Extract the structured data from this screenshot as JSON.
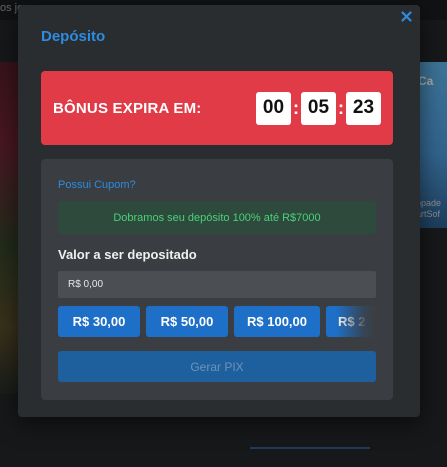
{
  "background": {
    "topbar_text": "os jo",
    "right_card_tag": "Ca",
    "right_card_caption_1": "ppade",
    "right_card_caption_2": "artSof"
  },
  "modal": {
    "title": "Depósito",
    "close_icon": "close-icon",
    "bonus": {
      "label": "BÔNUS EXPIRA EM:",
      "timer": {
        "hours": "00",
        "minutes": "05",
        "seconds": "23"
      }
    },
    "coupon_link": "Possui Cupom?",
    "promo_text": "Dobramos seu depósito 100% até R$7000",
    "amount_label": "Valor a ser depositado",
    "amount_placeholder": "R$ 0,00",
    "presets": [
      "R$ 30,00",
      "R$ 50,00",
      "R$ 100,00",
      "R$ 2"
    ],
    "submit_label": "Gerar PIX"
  },
  "colors": {
    "accent": "#2d8be0",
    "banner": "#e23b48",
    "promo_text": "#4ad17a",
    "button": "#1e6fc7"
  }
}
